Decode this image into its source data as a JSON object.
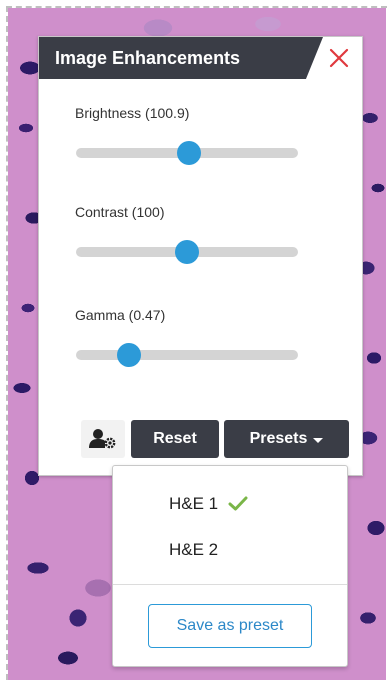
{
  "panel": {
    "title": "Image Enhancements",
    "close_icon": "close-icon"
  },
  "sliders": [
    {
      "name": "Brightness",
      "label": "Brightness (100.9)",
      "value": 100.9,
      "position": 0.51
    },
    {
      "name": "Contrast",
      "label": "Contrast (100)",
      "value": 100,
      "position": 0.5
    },
    {
      "name": "Gamma",
      "label": "Gamma (0.47)",
      "value": 0.47,
      "position": 0.24
    }
  ],
  "buttons": {
    "user_settings_icon": "user-gear-icon",
    "reset_label": "Reset",
    "presets_label": "Presets"
  },
  "presets_menu": {
    "items": [
      {
        "label": "H&E 1",
        "selected": true
      },
      {
        "label": "H&E 2",
        "selected": false
      }
    ],
    "save_label": "Save as preset"
  },
  "colors": {
    "header_bg": "#3a3d46",
    "accent": "#2c9ad8",
    "close": "#e0393e",
    "check": "#7ab648"
  }
}
